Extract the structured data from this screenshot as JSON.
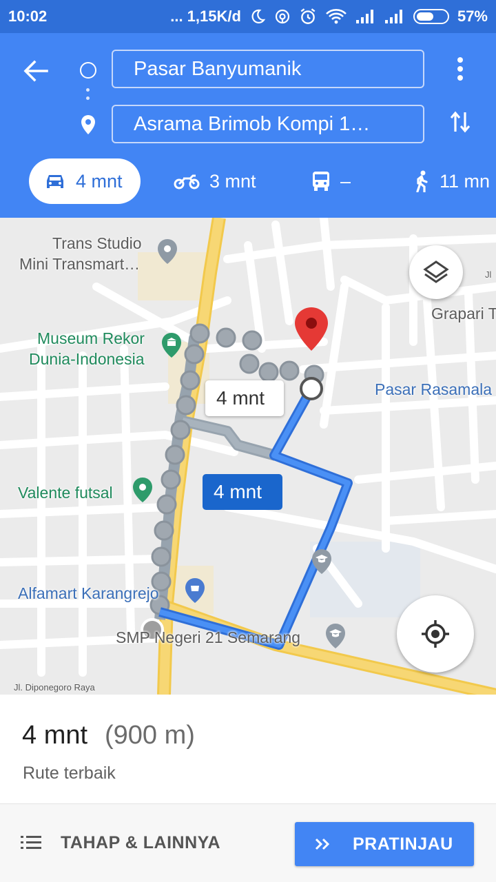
{
  "status_bar": {
    "time": "10:02",
    "network_speed": "... 1,15K/d",
    "battery_percent": "57%",
    "battery_level": 0.57
  },
  "directions": {
    "origin": "Pasar Banyumanik",
    "destination": "Asrama Brimob Kompi 1…",
    "modes": [
      {
        "name": "car",
        "icon": "car-icon",
        "label": "4 mnt",
        "selected": true
      },
      {
        "name": "motorcycle",
        "icon": "motorcycle-icon",
        "label": "3 mnt"
      },
      {
        "name": "transit",
        "icon": "bus-icon",
        "label": "–"
      },
      {
        "name": "walk",
        "icon": "walk-icon",
        "label": "11 mn"
      }
    ]
  },
  "map": {
    "places": [
      {
        "name": "Trans Studio Mini Transmart…",
        "line1": "Trans Studio",
        "line2": "Mini Transmart…",
        "icon": "pin-icon"
      },
      {
        "name": "Museum Rekor Dunia-Indonesia",
        "line1": "Museum Rekor",
        "line2": "Dunia-Indonesia",
        "icon": "museum-icon"
      },
      {
        "name": "Valente futsal",
        "icon": "pin-icon"
      },
      {
        "name": "Alfamart Karangrejo",
        "icon": "shopping-icon"
      },
      {
        "name": "SMP Negeri 21 Semarang",
        "icon": "school-icon"
      },
      {
        "name": "Grapari T",
        "icon": ""
      },
      {
        "name": "Pasar Rasamala",
        "icon": ""
      },
      {
        "name": "Jl",
        "icon": ""
      }
    ],
    "street": "Jl. Diponegoro Raya",
    "route_labels": {
      "alternate": "4 mnt",
      "selected": "4 mnt"
    },
    "colors": {
      "route_selected": "#4285f4",
      "route_alternate": "#a8b3bd",
      "destination_pin": "#e53935",
      "main_road": "#f7d774"
    }
  },
  "summary": {
    "duration": "4 mnt",
    "distance": "(900 m)",
    "note": "Rute terbaik"
  },
  "footer": {
    "steps_label": "TAHAP & LAINNYA",
    "preview_label": "PRATINJAU"
  }
}
